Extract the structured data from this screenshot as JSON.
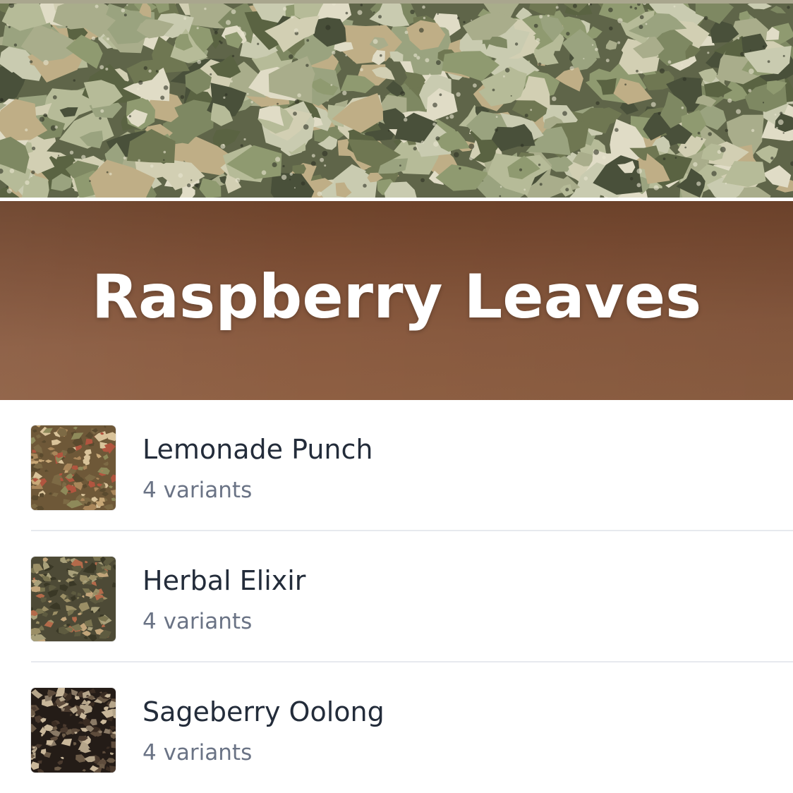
{
  "header": {
    "title": "Raspberry Leaves",
    "band_color": "#7a4c33",
    "hero_image": "dried-raspberry-leaves-image"
  },
  "products": [
    {
      "name": "Lemonade Punch",
      "subtitle": "4 variants",
      "thumbnail": "lemonade-punch-tea-image",
      "tone": "#8a6a45"
    },
    {
      "name": "Herbal Elixir",
      "subtitle": "4 variants",
      "thumbnail": "herbal-elixir-tea-image",
      "tone": "#6b6448"
    },
    {
      "name": "Sageberry Oolong",
      "subtitle": "4 variants",
      "thumbnail": "sageberry-oolong-tea-image",
      "tone": "#3a2e26"
    }
  ],
  "colors": {
    "title_text": "#ffffff",
    "item_title": "#232c3a",
    "item_subtitle": "#6a7385",
    "divider": "#e7e9ee"
  }
}
